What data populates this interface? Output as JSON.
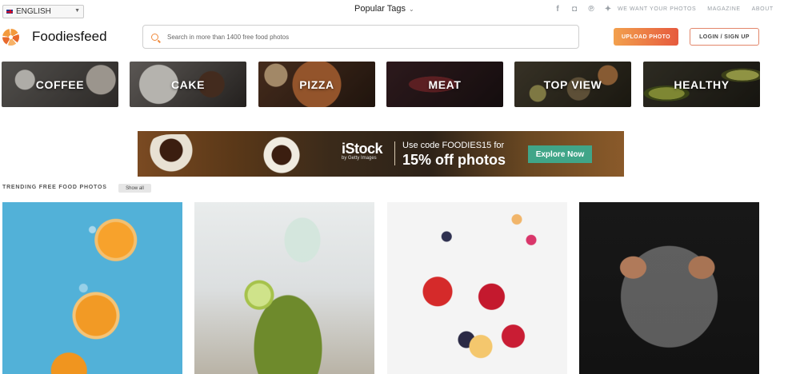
{
  "topbar": {
    "language": "ENGLISH",
    "popular_tags": "Popular Tags",
    "social_icons": [
      "facebook-icon",
      "instagram-icon",
      "pinterest-icon",
      "twitter-icon"
    ],
    "links": [
      "WE WANT YOUR PHOTOS",
      "MAGAZINE",
      "ABOUT"
    ]
  },
  "header": {
    "brand": "Foodiesfeed",
    "search_placeholder": "Search in more than 1400 free food photos",
    "upload_label": "UPLOAD PHOTO",
    "login_label": "LOGIN / SIGN UP",
    "accent_color": "#e86a2c"
  },
  "categories": [
    "COFFEE",
    "CAKE",
    "PIZZA",
    "MEAT",
    "TOP VIEW",
    "HEALTHY"
  ],
  "ad": {
    "brand": "iStock",
    "brand_sub": "by Getty Images",
    "line1": "Use code FOODIES15 for",
    "line2": "15% off photos",
    "cta": "Explore Now",
    "cta_color": "#40a588"
  },
  "trending": {
    "title": "TRENDING FREE FOOD PHOTOS",
    "show_all": "Show all"
  }
}
